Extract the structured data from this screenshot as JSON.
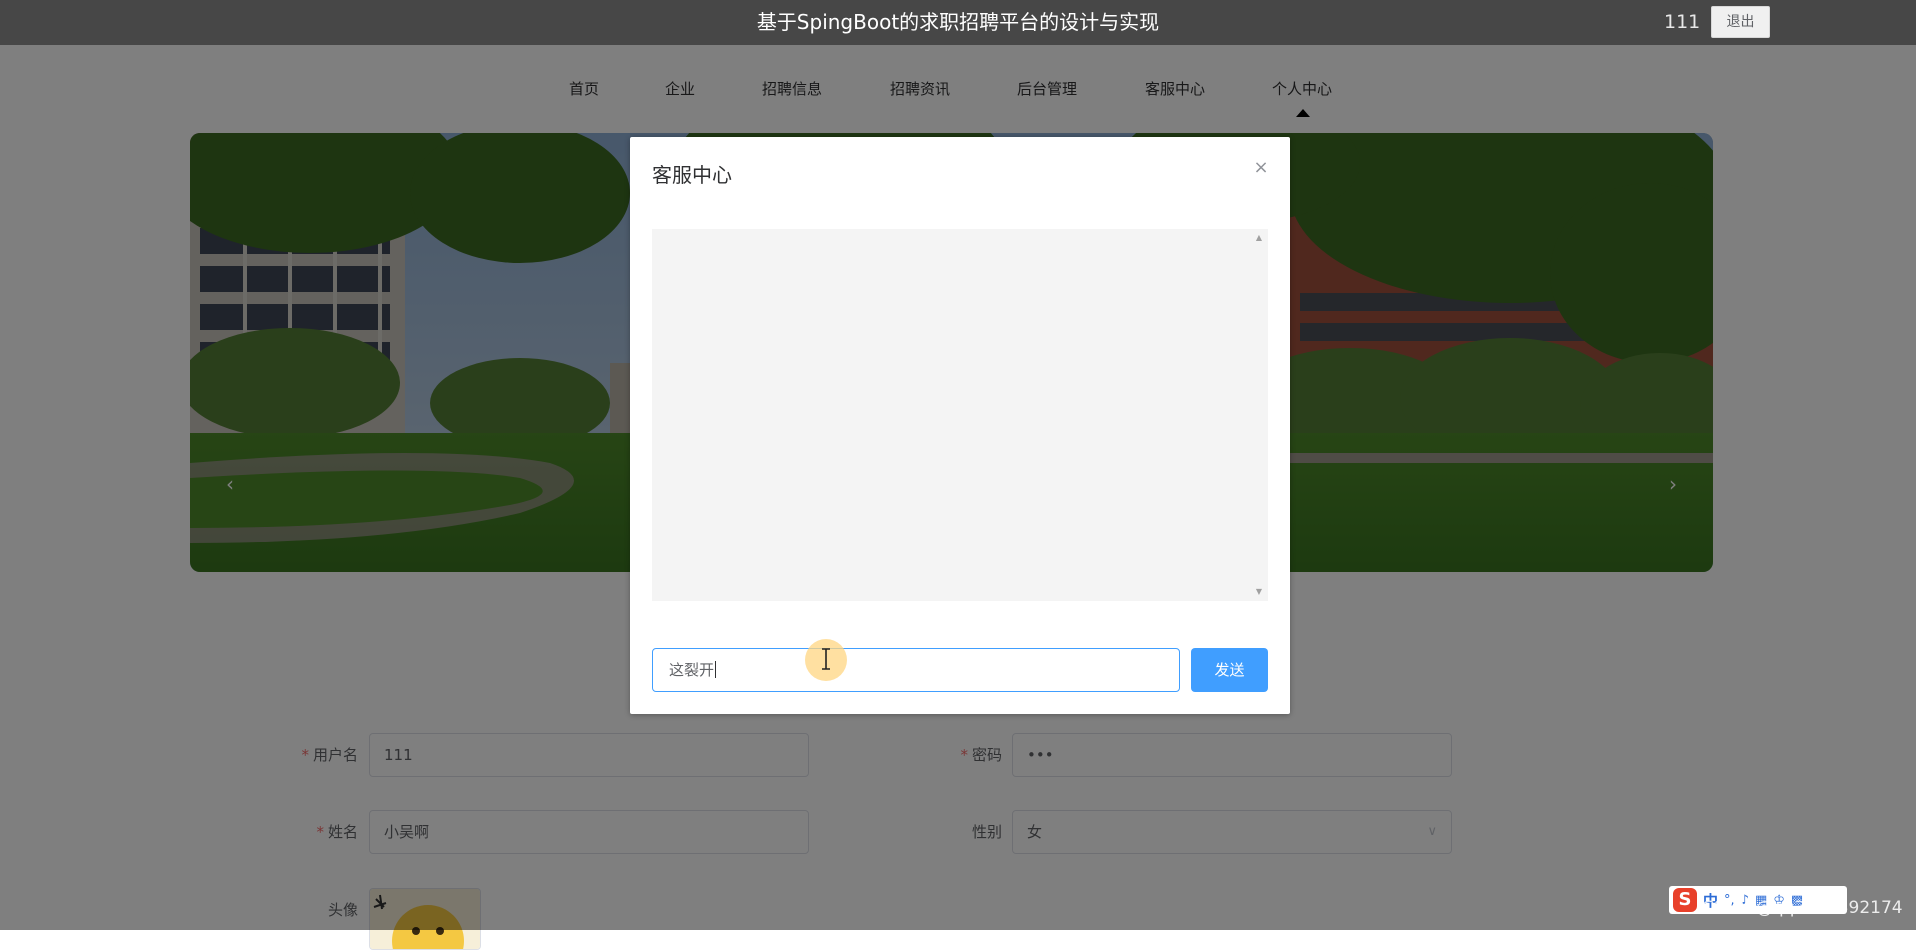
{
  "header": {
    "site_title": "基于SpingBoot的求职招聘平台的设计与实现",
    "username": "111",
    "logout_label": "退出"
  },
  "nav": {
    "items": [
      "首页",
      "企业",
      "招聘信息",
      "招聘资讯",
      "后台管理",
      "客服中心",
      "个人中心"
    ],
    "active_index": 6
  },
  "carousel": {
    "prev_icon": "‹",
    "next_icon": "›"
  },
  "form": {
    "username": {
      "label": "用户名",
      "value": "111",
      "required": true
    },
    "password": {
      "label": "密码",
      "value": "•••",
      "required": true
    },
    "name": {
      "label": "姓名",
      "value": "小吴啊",
      "required": true
    },
    "gender": {
      "label": "性别",
      "value": "女",
      "required": false
    },
    "avatar": {
      "label": "头像"
    }
  },
  "dialog": {
    "title": "客服中心",
    "close_icon": "×",
    "message_input_value": "这裂开",
    "send_label": "发送"
  },
  "ime": {
    "mode": "中",
    "glyphs": [
      "°,",
      "♪",
      "▦",
      "♔",
      "▩"
    ]
  },
  "watermark": "CSDN @qq3360392174",
  "colors": {
    "topbar": "#474747",
    "primary": "#409eff",
    "overlay": "rgba(0,0,0,0.5)",
    "required": "#f56c6c"
  }
}
